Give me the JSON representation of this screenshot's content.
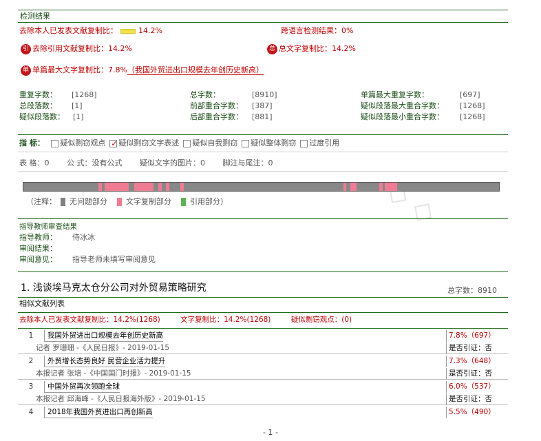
{
  "detection": {
    "section_title": "检测结果",
    "excl_self_label": "去除本人已发表文献复制比：",
    "excl_self_value": "14.2%",
    "cross_lang": "跨语言检测结果：0%",
    "excl_ref_label": "去除引用文献复制比：",
    "excl_ref_value": "14.2%",
    "icon_ref": "引",
    "icon_total": "总",
    "total_copy_label": "总文字复制比：",
    "total_copy_value": "14.2%",
    "icon_single": "单",
    "single_max_label": "单篇最大文字复制比：",
    "single_max_value": "7.8%",
    "single_max_title": "（我国外贸进出口规模去年创历史新高）"
  },
  "stats": [
    {
      "label": "重复字数：",
      "value": "[1268]"
    },
    {
      "label": "总字数：",
      "value": "[8910]"
    },
    {
      "label": "单篇最大重复字数：",
      "value": "[697]"
    },
    {
      "label": "总段落数：",
      "value": "[1]"
    },
    {
      "label": "前部重合字数：",
      "value": "[387]"
    },
    {
      "label": "疑似段落最大重合字数：",
      "value": "[1268]"
    },
    {
      "label": "疑似段落数：",
      "value": "[1]"
    },
    {
      "label": "后部重合字数：",
      "value": "[881]"
    },
    {
      "label": "疑似段落最小重合字数：",
      "value": "[1268]"
    }
  ],
  "indicators": {
    "label": "指 标：",
    "items": [
      {
        "text": "疑似剽窃观点",
        "checked": false
      },
      {
        "text": "疑似剽窃文字表述",
        "checked": true
      },
      {
        "text": "疑似自我剽窃",
        "checked": false
      },
      {
        "text": "疑似整体剽窃",
        "checked": false
      },
      {
        "text": "过度引用",
        "checked": false
      }
    ]
  },
  "counts": {
    "table": "表 格：0",
    "formula": "公 式：没有公式",
    "images": "疑似文字的图片：0",
    "footnotes": "脚注与尾注：0"
  },
  "legend": {
    "prefix": "（注释：",
    "no_issue": "无问题部分",
    "copied": "文字复制部分",
    "cited": "引用部分）",
    "color_gray": "#808080",
    "color_pink": "#f07c93",
    "color_green": "#5fb356"
  },
  "review": {
    "title": "指导教师审查结果",
    "teacher_label": "指导教师：",
    "teacher_value": "侍冰冰",
    "result_label": "审阅结果：",
    "opinion_label": "审阅意见：",
    "opinion_value": "指导老师未填写审阅意见"
  },
  "paper": {
    "title": "1. 浅谈埃马克太仓分公司对外贸易策略研究",
    "total_chars": "总字数：8910",
    "similar_list": "相似文献列表",
    "s1": "去除本人已发表文献复制比：14.2%(1268)",
    "s2": "文字复制比：14.2%(1268)",
    "s3": "疑似剽窃观点：(0)"
  },
  "references": [
    {
      "num": "1",
      "title": "我国外贸进出口规模去年创历史新高",
      "ratio": "7.8%（697）",
      "source": "记者 罗珊珊 -《人民日报》- 2019-01-15",
      "cite": "是否引证：否"
    },
    {
      "num": "2",
      "title": "外贸增长态势良好 民营企业活力提升",
      "ratio": "7.3%（648）",
      "source": "本报记者 张培 -《中国国门时报》- 2019-01-15",
      "cite": "是否引证：否"
    },
    {
      "num": "3",
      "title": "中国外贸再次领跑全球",
      "ratio": "6.0%（537）",
      "source": "本报记者 邱海峰 -《人民日报海外版》- 2019-01-15",
      "cite": "是否引证：否"
    },
    {
      "num": "4",
      "title": "2018年我国外贸进出口再创新高",
      "ratio": "5.5%（490）"
    }
  ],
  "page_number": "- 1 -"
}
